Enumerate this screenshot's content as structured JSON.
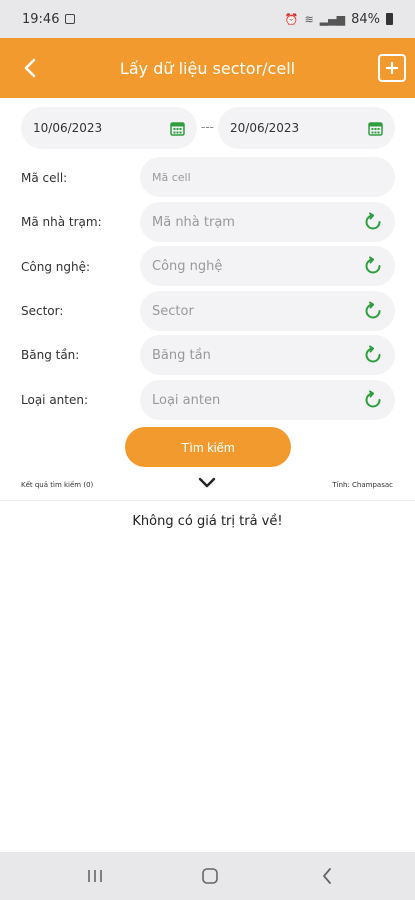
{
  "status_bar": {
    "time": "19:46",
    "battery": "84%"
  },
  "header": {
    "title": "Lấy dữ liệu sector/cell"
  },
  "dates": {
    "from": "10/06/2023",
    "separator": "---",
    "to": "20/06/2023"
  },
  "form": {
    "rows": [
      {
        "label": "Mã cell:",
        "placeholder": "Mã cell",
        "refresh": false
      },
      {
        "label": "Mã nhà trạm:",
        "placeholder": "Mã nhà trạm",
        "refresh": true
      },
      {
        "label": "Công nghệ:",
        "placeholder": "Công nghệ",
        "refresh": true
      },
      {
        "label": "Sector:",
        "placeholder": "Sector",
        "refresh": true
      },
      {
        "label": "Băng tần:",
        "placeholder": "Băng tần",
        "refresh": true
      },
      {
        "label": "Loại anten:",
        "placeholder": "Loại anten",
        "refresh": true
      }
    ],
    "search_label": "Tìm kiếm"
  },
  "results": {
    "count_label": "Kết quả tìm kiếm (0)",
    "province_label": "Tỉnh: Champasac",
    "empty_message": "Không có giá trị trả về!"
  },
  "colors": {
    "accent": "#f29a2e",
    "icon_green": "#2e9e3e"
  },
  "icons": {
    "back": "chevron-left-icon",
    "add": "plus-square-icon",
    "calendar": "calendar-icon",
    "refresh": "refresh-icon",
    "expand": "chevron-down-icon"
  }
}
